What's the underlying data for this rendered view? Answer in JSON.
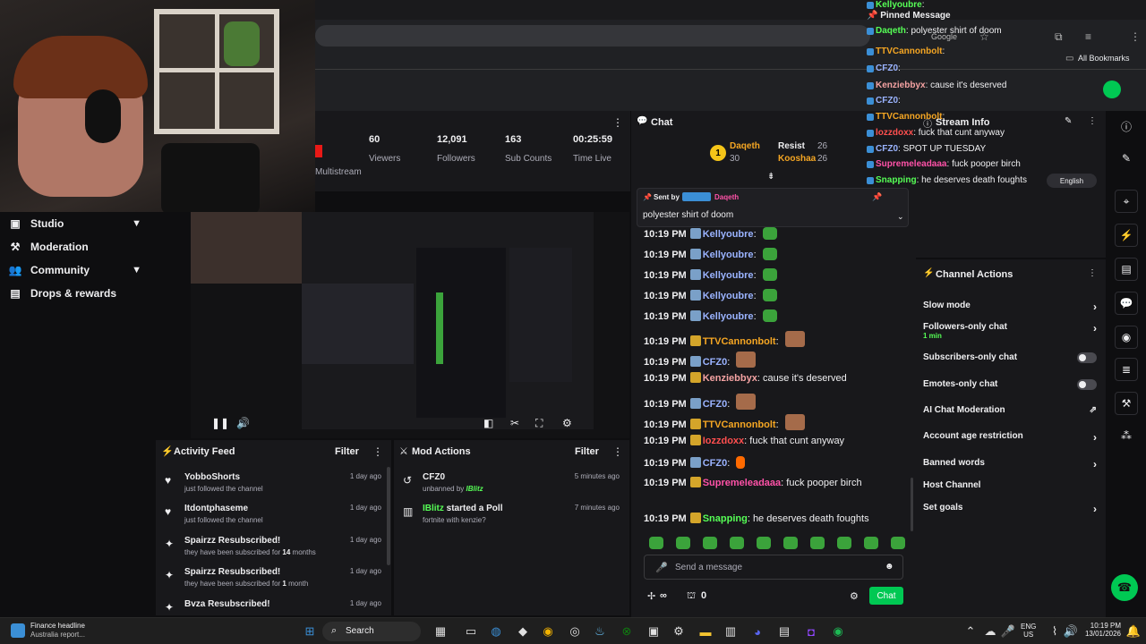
{
  "browser": {
    "all_bookmarks": "All Bookmarks",
    "search_hint": "Google"
  },
  "sidenav": {
    "items": [
      {
        "label": "Studio",
        "chevron": true
      },
      {
        "label": "Moderation",
        "chevron": false
      },
      {
        "label": "Community",
        "chevron": true
      },
      {
        "label": "Drops & rewards",
        "chevron": false
      }
    ]
  },
  "stats": {
    "multistream": "Multistream",
    "items": [
      {
        "value": "60",
        "label": "Viewers"
      },
      {
        "value": "12,091",
        "label": "Followers"
      },
      {
        "value": "163",
        "label": "Sub Counts"
      },
      {
        "value": "00:25:59",
        "label": "Time Live"
      }
    ]
  },
  "activity": {
    "title": "Activity Feed",
    "filter": "Filter",
    "items": [
      {
        "icon": "heart-icon",
        "glyph": "♥",
        "title": "YobboShorts",
        "sub": "just followed the channel",
        "time": "1 day ago"
      },
      {
        "icon": "heart-icon",
        "glyph": "♥",
        "title": "Itdontphaseme",
        "sub": "just followed the channel",
        "time": "1 day ago"
      },
      {
        "icon": "star-icon",
        "glyph": "✦",
        "title": "Spairzz Resubscribed!",
        "sub_pre": "they have been subscribed for ",
        "sub_num": "14",
        "sub_post": " months",
        "time": "1 day ago"
      },
      {
        "icon": "star-icon",
        "glyph": "✦",
        "title": "Spairzz Resubscribed!",
        "sub_pre": "they have been subscribed for ",
        "sub_num": "1",
        "sub_post": " month",
        "time": "1 day ago"
      },
      {
        "icon": "star-icon",
        "glyph": "✦",
        "title": "Bvza Resubscribed!",
        "sub": "",
        "time": "1 day ago"
      }
    ]
  },
  "mod": {
    "title": "Mod Actions",
    "filter": "Filter",
    "items": [
      {
        "title": "CFZ0",
        "sub_pre": "unbanned by ",
        "sub_user": "IBlitz",
        "time": "5 minutes ago"
      },
      {
        "title_user": "IBlitz",
        "title_rest": " started a Poll",
        "sub": "fortnite with kenzie?",
        "time": "7 minutes ago"
      }
    ]
  },
  "chat": {
    "title": "Chat",
    "leaderboard": [
      {
        "name": "Daqeth",
        "count": "30"
      },
      {
        "name": "Resist",
        "count": "26"
      },
      {
        "name": "Kooshaa",
        "count": "26"
      }
    ],
    "pinned": {
      "sent_by": "Sent by",
      "user": "Daqeth",
      "text": "polyester shirt of doom"
    },
    "messages": [
      {
        "time": "10:19 PM",
        "user": "Kellyoubre",
        "cls": "u-blue",
        "text": "",
        "emote": "green"
      },
      {
        "time": "10:19 PM",
        "user": "Kellyoubre",
        "cls": "u-blue",
        "text": "",
        "emote": "green"
      },
      {
        "time": "10:19 PM",
        "user": "Kellyoubre",
        "cls": "u-blue",
        "text": "",
        "emote": "green"
      },
      {
        "time": "10:19 PM",
        "user": "Kellyoubre",
        "cls": "u-blue",
        "text": "",
        "emote": "green"
      },
      {
        "time": "10:19 PM",
        "user": "Kellyoubre",
        "cls": "u-blue",
        "text": "",
        "emote": "green"
      },
      {
        "time": "10:19 PM",
        "user": "TTVCannonbolt",
        "cls": "u-gold",
        "text": "",
        "emote": "face"
      },
      {
        "time": "10:19 PM",
        "user": "CFZ0",
        "cls": "u-blue",
        "text": "",
        "emote": "face"
      },
      {
        "time": "10:19 PM",
        "user": "Kenziebbyx",
        "cls": "u-pink",
        "text": "cause it's deserved",
        "emote": ""
      },
      {
        "time": "10:19 PM",
        "user": "CFZ0",
        "cls": "u-blue",
        "text": "",
        "emote": "face"
      },
      {
        "time": "10:19 PM",
        "user": "TTVCannonbolt",
        "cls": "u-gold",
        "text": "",
        "emote": "face"
      },
      {
        "time": "10:19 PM",
        "user": "Iozzdoxx",
        "cls": "u-red",
        "text": "fuck that cunt anyway",
        "emote": ""
      },
      {
        "time": "10:19 PM",
        "user": "CFZ0",
        "cls": "u-blue",
        "text": "",
        "emote": "fire"
      },
      {
        "time": "10:19 PM",
        "user": "Supremeleadaaa",
        "cls": "u-mag",
        "text": "fuck pooper birch",
        "emote": ""
      },
      {
        "time": "10:19 PM",
        "user": "Snapping",
        "cls": "u-green",
        "text": "he deserves death foughts",
        "emote": ""
      }
    ],
    "placeholder": "Send a message",
    "points": "∞",
    "bits": "0",
    "send": "Chat"
  },
  "actions": {
    "title": "Channel Actions",
    "items": [
      {
        "label": "Slow mode",
        "type": "chev"
      },
      {
        "label": "Followers-only chat",
        "sub": "1 min",
        "type": "chev"
      },
      {
        "label": "Subscribers-only chat",
        "type": "toggle"
      },
      {
        "label": "Emotes-only chat",
        "type": "toggle"
      },
      {
        "label": "AI Chat Moderation",
        "type": "ext"
      },
      {
        "label": "Account age restriction",
        "type": "chev"
      },
      {
        "label": "Banned words",
        "type": "chev"
      },
      {
        "label": "Host Channel",
        "type": "none"
      },
      {
        "label": "Set goals",
        "type": "chev"
      }
    ]
  },
  "overlay": {
    "pinned_title": "Pinned Message",
    "stream_info": "Stream Info",
    "language": "English",
    "lines": [
      {
        "user": "Kellyoubre",
        "cls": "u-green",
        "text": ""
      },
      {
        "user": "Daqeth",
        "cls": "u-green",
        "text": "polyester shirt of doom"
      },
      {
        "user": "TTVCannonbolt",
        "cls": "u-gold",
        "text": ""
      },
      {
        "user": "CFZ0",
        "cls": "u-blue",
        "text": ""
      },
      {
        "user": "Kenziebbyx",
        "cls": "u-pink",
        "text": "cause it's deserved"
      },
      {
        "user": "CFZ0",
        "cls": "u-blue",
        "text": ""
      },
      {
        "user": "TTVCannonbolt",
        "cls": "u-gold",
        "text": ""
      },
      {
        "user": "lozzdoxx",
        "cls": "u-red",
        "text": "fuck that cunt anyway"
      },
      {
        "user": "CFZ0",
        "cls": "u-blue",
        "text": "SPOT UP TUESDAY"
      },
      {
        "user": "Supremeleadaaa",
        "cls": "u-mag",
        "text": "fuck pooper birch"
      },
      {
        "user": "Snapping",
        "cls": "u-green",
        "text": "he deserves death foughts"
      }
    ]
  },
  "taskbar": {
    "news_title": "Finance headline",
    "news_sub": "Australia report...",
    "search": "Search",
    "lang1": "ENG",
    "lang2": "US",
    "time": "10:19 PM",
    "date": "13/01/2026"
  },
  "colors": {
    "accent": "#00c853",
    "panel": "#18181b",
    "bg": "#0e0e10"
  }
}
